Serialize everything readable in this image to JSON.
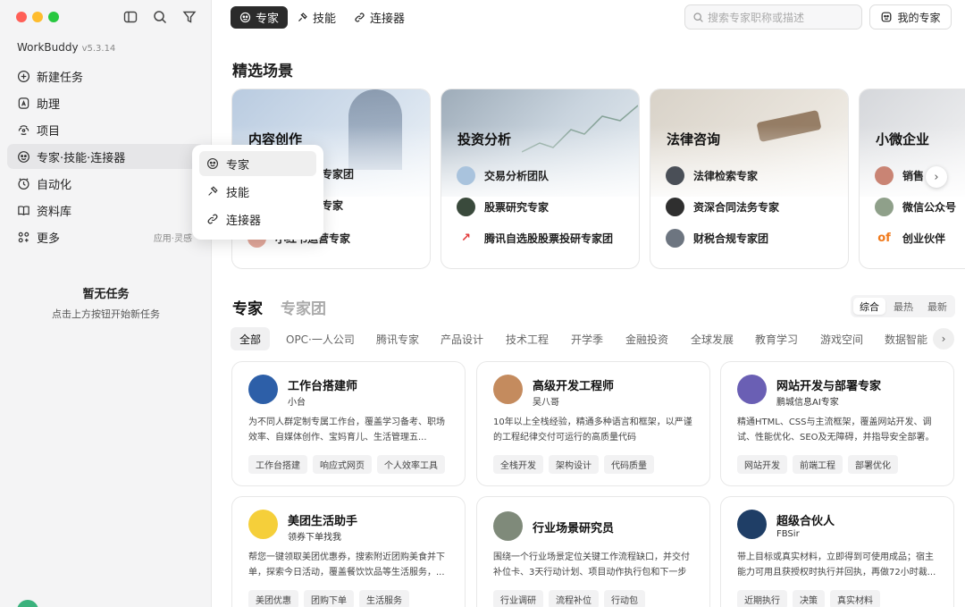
{
  "sidebar": {
    "app_name": "WorkBuddy",
    "version": "v5.3.14",
    "nav": [
      {
        "label": "新建任务",
        "icon": "plus-circle-icon"
      },
      {
        "label": "助理",
        "icon": "assistant-icon"
      },
      {
        "label": "项目",
        "icon": "folder-icon"
      },
      {
        "label": "专家·技能·连接器",
        "icon": "expert-icon"
      },
      {
        "label": "自动化",
        "icon": "clock-icon"
      },
      {
        "label": "资料库",
        "icon": "book-icon"
      },
      {
        "label": "更多",
        "icon": "grid-icon",
        "extra": "应用·灵感"
      }
    ],
    "empty_title": "暂无任务",
    "empty_sub": "点击上方按钮开始新任务"
  },
  "popup": {
    "items": [
      "专家",
      "技能",
      "连接器"
    ]
  },
  "top_tabs": [
    "专家",
    "技能",
    "连接器"
  ],
  "search": {
    "placeholder": "搜索专家职称或描述"
  },
  "my_experts_label": "我的专家",
  "featured": {
    "title": "精选场景",
    "scenes": [
      {
        "title": "内容创作",
        "items": [
          "专家团",
          "专家",
          "小红书运营专家"
        ]
      },
      {
        "title": "投资分析",
        "items": [
          "交易分析团队",
          "股票研究专家",
          "腾讯自选股股票投研专家团"
        ]
      },
      {
        "title": "法律咨询",
        "items": [
          "法律检索专家",
          "资深合同法务专家",
          "财税合规专家团"
        ]
      },
      {
        "title": "小微企业",
        "items": [
          "销售",
          "微信公众号",
          "创业伙伴"
        ]
      }
    ]
  },
  "section_tabs": [
    "专家",
    "专家团"
  ],
  "sort": [
    "综合",
    "最热",
    "最新"
  ],
  "categories": [
    "全部",
    "OPC·一人公司",
    "腾讯专家",
    "产品设计",
    "技术工程",
    "开学季",
    "金融投资",
    "全球发展",
    "教育学习",
    "游戏空间",
    "数据智能"
  ],
  "cards": [
    {
      "name": "工作台搭建师",
      "author": "小台",
      "desc": "为不同人群定制专属工作台，覆盖学习备考、职场效率、自媒体创作、宝妈育儿、生活管理五...",
      "tags": [
        "工作台搭建",
        "响应式网页",
        "个人效率工具"
      ]
    },
    {
      "name": "高级开发工程师",
      "author": "吴八哥",
      "desc": "10年以上全栈经验，精通多种语言和框架，以严谨的工程纪律交付可运行的高质量代码",
      "tags": [
        "全栈开发",
        "架构设计",
        "代码质量"
      ]
    },
    {
      "name": "网站开发与部署专家",
      "author": "鹏城信息AI专家",
      "desc": "精通HTML、CSS与主流框架，覆盖网站开发、调试、性能优化、SEO及无障碍，并指导安全部署。",
      "tags": [
        "网站开发",
        "前端工程",
        "部署优化"
      ]
    },
    {
      "name": "美团生活助手",
      "author": "领券下单找我",
      "desc": "帮您一键领取美团优惠券，搜索附近团购美食并下单，探索今日活动，覆盖餐饮饮品等生活服务，...",
      "tags": [
        "美团优惠",
        "团购下单",
        "生活服务"
      ]
    },
    {
      "name": "行业场景研究员",
      "author": "",
      "desc": "围绕一个行业场景定位关键工作流程缺口，并交付补位卡、3天行动计划、项目动作执行包和下一步建...",
      "tags": [
        "行业调研",
        "流程补位",
        "行动包"
      ]
    },
    {
      "name": "超级合伙人",
      "author": "FBSir",
      "desc": "带上目标或真实材料，立即得到可使用成品；宿主能力可用且获授权时执行并回执，再做72小时裁...",
      "tags": [
        "近期执行",
        "决策",
        "真实材料"
      ]
    }
  ]
}
